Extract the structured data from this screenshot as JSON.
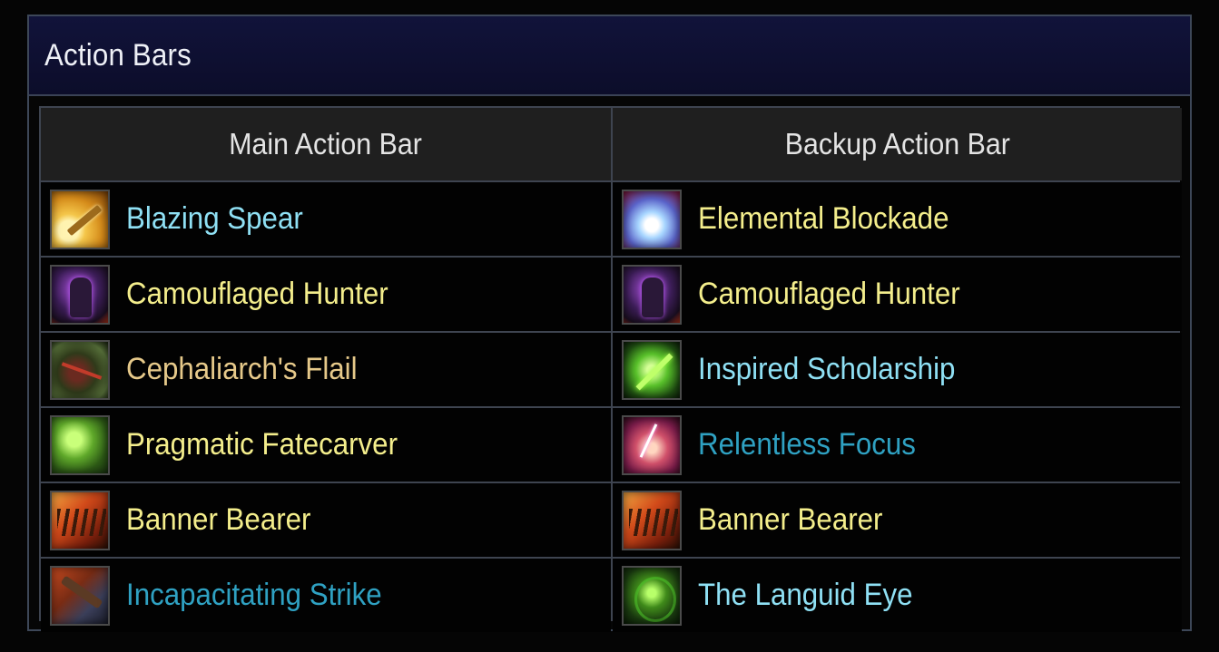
{
  "panel": {
    "title": "Action Bars"
  },
  "columns": [
    "Main Action Bar",
    "Backup Action Bar"
  ],
  "colors": {
    "gold": "#f4ee8c",
    "cyan": "#8fe0f4",
    "tan": "#e6c98a",
    "blue": "#2fa1c2"
  },
  "rows": [
    {
      "main": {
        "label": "Blazing Spear",
        "icon": "blazing-spear-icon",
        "color": "#8fe0f4"
      },
      "backup": {
        "label": "Elemental Blockade",
        "icon": "elemental-blockade-icon",
        "color": "#f4ee8c"
      }
    },
    {
      "main": {
        "label": "Camouflaged Hunter",
        "icon": "camouflaged-hunter-icon",
        "color": "#f4ee8c"
      },
      "backup": {
        "label": "Camouflaged Hunter",
        "icon": "camouflaged-hunter-icon",
        "color": "#f4ee8c"
      }
    },
    {
      "main": {
        "label": "Cephaliarch's Flail",
        "icon": "cephaliarchs-flail-icon",
        "color": "#e6c98a"
      },
      "backup": {
        "label": "Inspired Scholarship",
        "icon": "inspired-scholarship-icon",
        "color": "#8fe0f4"
      }
    },
    {
      "main": {
        "label": "Pragmatic Fatecarver",
        "icon": "pragmatic-fatecarver-icon",
        "color": "#f4ee8c"
      },
      "backup": {
        "label": "Relentless Focus",
        "icon": "relentless-focus-icon",
        "color": "#2fa1c2"
      }
    },
    {
      "main": {
        "label": "Banner Bearer",
        "icon": "banner-bearer-icon",
        "color": "#f4ee8c"
      },
      "backup": {
        "label": "Banner Bearer",
        "icon": "banner-bearer-icon",
        "color": "#f4ee8c"
      }
    },
    {
      "main": {
        "label": "Incapacitating Strike",
        "icon": "incapacitating-strike-icon",
        "color": "#2fa1c2"
      },
      "backup": {
        "label": "The Languid Eye",
        "icon": "languid-eye-icon",
        "color": "#8fe0f4"
      }
    }
  ]
}
